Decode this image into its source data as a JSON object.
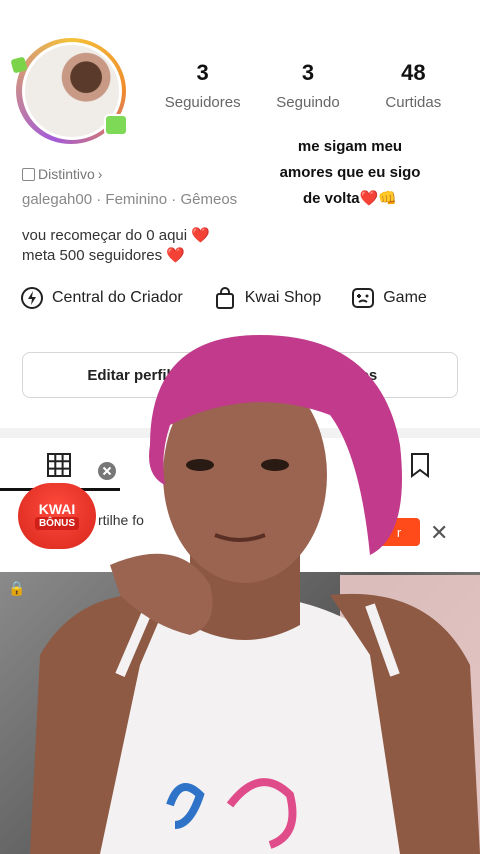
{
  "profile": {
    "username": "galegah00",
    "gender": "Feminino",
    "sign": "Gêmeos",
    "badge_label": "Distintivo",
    "bio_lines": [
      "vou recomeçar do 0 aqui ❤️",
      "meta 500 seguidores ❤️"
    ]
  },
  "stats": [
    {
      "value": "3",
      "label": "Seguidores"
    },
    {
      "value": "3",
      "label": "Seguindo"
    },
    {
      "value": "48",
      "label": "Curtidas"
    }
  ],
  "caption_lines": [
    "me sigam meu",
    "amores que eu sigo",
    "de volta❤️👊"
  ],
  "shortcuts": [
    {
      "label": "Central do Criador",
      "icon": "lightning-circle-icon"
    },
    {
      "label": "Kwai Shop",
      "icon": "shopping-bag-icon"
    },
    {
      "label": "Game",
      "icon": "gamepad-icon"
    }
  ],
  "actions": {
    "edit_profile": "Editar perfil",
    "friends": "amigos"
  },
  "promo": {
    "badge_line1": "KWAI",
    "badge_line2": "BÔNUS",
    "text": "rtilhe fo",
    "button": "r"
  },
  "colors": {
    "accent": "#ff4a1a",
    "badge_red": "#e0261c",
    "divider": "#f2f2f2"
  }
}
